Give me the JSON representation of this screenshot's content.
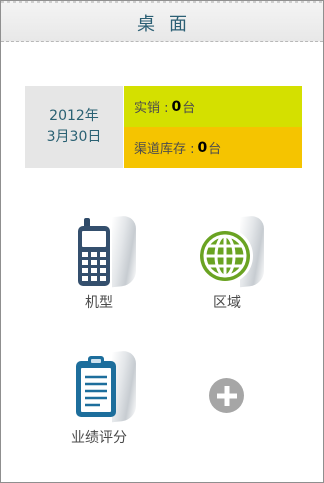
{
  "header": {
    "title": "桌面"
  },
  "summary": {
    "date_line1": "2012年",
    "date_line2": "3月30日",
    "sold_label": "实销 :",
    "sold_value": "0",
    "sold_unit": "台",
    "stock_label": "渠道库存 :",
    "stock_value": "0",
    "stock_unit": "台",
    "colors": {
      "date_bg": "#e6e6e6",
      "sold_bg": "#d4e000",
      "stock_bg": "#f5c400"
    }
  },
  "tiles": [
    {
      "label": "机型",
      "icon": "mobile-phone-icon"
    },
    {
      "label": "区域",
      "icon": "globe-icon"
    },
    {
      "label": "业绩评分",
      "icon": "clipboard-icon"
    }
  ],
  "add_tile": {
    "icon": "plus-circle-icon"
  }
}
